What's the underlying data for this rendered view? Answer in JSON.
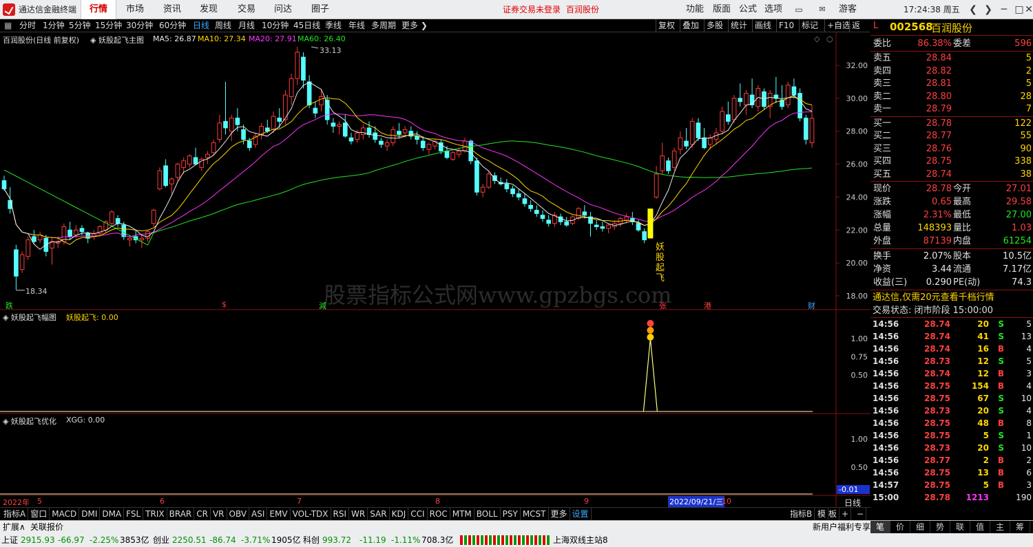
{
  "app": {
    "title": "通达信金融终端",
    "tabs": [
      "行情",
      "市场",
      "资讯",
      "发现",
      "交易",
      "问达",
      "圈子"
    ],
    "notice": "证券交易未登录",
    "stock_name_top": "百润股份",
    "menus": [
      "功能",
      "版面",
      "公式",
      "选项"
    ],
    "user": "游客",
    "time": "17:24:38 周五"
  },
  "periods": [
    "分时",
    "1分钟",
    "5分钟",
    "15分钟",
    "30分钟",
    "60分钟",
    "日线",
    "周线",
    "月线",
    "10分钟",
    "45日线",
    "季线",
    "年线",
    "多周期",
    "更多"
  ],
  "toolbar_right": [
    "复权",
    "叠加",
    "多股",
    "统计",
    "画线",
    "F10",
    "标记",
    "+自选",
    "返回"
  ],
  "main": {
    "title": "百润股份(日线 前复权)",
    "indicator": "妖股起飞主图",
    "ma5": "MA5: 26.87",
    "ma10": "MA10: 27.34",
    "ma20": "MA20: 27.91",
    "ma60": "MA60: 26.40",
    "high_mark": "33.13",
    "low_mark": "18.34",
    "yaxis": [
      "32.00",
      "30.00",
      "28.00",
      "26.00",
      "24.00",
      "22.00",
      "20.00",
      "18.00"
    ],
    "signal_text": [
      "妖",
      "股",
      "起",
      "飞"
    ],
    "watermark": "股票指标公式网www.gpzbgs.com",
    "events": [
      "跌",
      "$",
      "減",
      "张",
      "港",
      "财"
    ]
  },
  "sub1": {
    "title": "妖股起飞幅图",
    "value": "妖股起飞: 0.00",
    "yaxis": [
      "1.00",
      "0.75",
      "0.50"
    ]
  },
  "sub2": {
    "title": "妖股起飞优化",
    "value": "XGG: 0.00",
    "yaxis": [
      "1.00",
      "0.50",
      "-0.01"
    ]
  },
  "xaxis": {
    "labels": [
      "2022年",
      "5",
      "6",
      "7",
      "8",
      "9",
      "10"
    ],
    "cursor_date": "2022/09/21/三",
    "period": "日线"
  },
  "indicators": [
    "指标A",
    "窗口",
    "MACD",
    "DMI",
    "DMA",
    "FSL",
    "TRIX",
    "BRAR",
    "CR",
    "VR",
    "OBV",
    "ASI",
    "EMV",
    "VOL-TDX",
    "RSI",
    "WR",
    "SAR",
    "KDJ",
    "CCI",
    "ROC",
    "MTM",
    "BOLL",
    "PSY",
    "MCST",
    "更多",
    "设置"
  ],
  "indicators_right": [
    "指标B",
    "模",
    "板",
    "+",
    "−"
  ],
  "quote": {
    "code": "002568",
    "name": "百润股份",
    "weibi_label": "委比",
    "weibi": "86.38%",
    "weicha_label": "委差",
    "weicha": "596",
    "sells": [
      {
        "l": "卖五",
        "p": "28.84",
        "v": "5"
      },
      {
        "l": "卖四",
        "p": "28.82",
        "v": "2"
      },
      {
        "l": "卖三",
        "p": "28.81",
        "v": "5"
      },
      {
        "l": "卖二",
        "p": "28.80",
        "v": "28"
      },
      {
        "l": "卖一",
        "p": "28.79",
        "v": "7"
      }
    ],
    "buys": [
      {
        "l": "买一",
        "p": "28.78",
        "v": "122"
      },
      {
        "l": "买二",
        "p": "28.77",
        "v": "55"
      },
      {
        "l": "买三",
        "p": "28.76",
        "v": "90"
      },
      {
        "l": "买四",
        "p": "28.75",
        "v": "338"
      },
      {
        "l": "买五",
        "p": "28.74",
        "v": "38"
      }
    ],
    "stats": [
      [
        "现价",
        "28.78",
        "今开",
        "27.01"
      ],
      [
        "涨跌",
        "0.65",
        "最高",
        "29.58"
      ],
      [
        "涨幅",
        "2.31%",
        "最低",
        "27.00"
      ],
      [
        "总量",
        "148393",
        "量比",
        "1.03"
      ],
      [
        "外盘",
        "87139",
        "内盘",
        "61254"
      ],
      [
        "换手",
        "2.07%",
        "股本",
        "10.5亿"
      ],
      [
        "净资",
        "3.44",
        "流通",
        "7.17亿"
      ],
      [
        "收益(三)",
        "0.290",
        "PE(动)",
        "74.3"
      ]
    ],
    "ad": "通达信,仅需20元查看千档行情",
    "trade_status": "交易状态: 闭市阶段 15:00:00",
    "ticks": [
      [
        "14:56",
        "28.74",
        "20",
        "S",
        "5"
      ],
      [
        "14:56",
        "28.74",
        "41",
        "S",
        "13"
      ],
      [
        "14:56",
        "28.74",
        "16",
        "B",
        "4"
      ],
      [
        "14:56",
        "28.73",
        "12",
        "S",
        "5"
      ],
      [
        "14:56",
        "28.74",
        "12",
        "B",
        "3"
      ],
      [
        "14:56",
        "28.75",
        "154",
        "B",
        "4"
      ],
      [
        "14:56",
        "28.75",
        "67",
        "S",
        "10"
      ],
      [
        "14:56",
        "28.73",
        "20",
        "S",
        "4"
      ],
      [
        "14:56",
        "28.75",
        "48",
        "B",
        "8"
      ],
      [
        "14:56",
        "28.75",
        "5",
        "S",
        "1"
      ],
      [
        "14:56",
        "28.73",
        "20",
        "S",
        "10"
      ],
      [
        "14:56",
        "28.77",
        "2",
        "B",
        "2"
      ],
      [
        "14:56",
        "28.75",
        "13",
        "B",
        "6"
      ],
      [
        "14:57",
        "28.75",
        "5",
        "B",
        "3"
      ],
      [
        "15:00",
        "28.78",
        "1213",
        "",
        "190"
      ]
    ],
    "tabs": [
      "笔",
      "价",
      "细",
      "势",
      "联",
      "值",
      "主",
      "筹"
    ]
  },
  "statusbar": {
    "items": [
      [
        "上证",
        "2915.93",
        "-66.97",
        "-2.25%",
        "3853亿"
      ],
      [
        "创业",
        "2250.51",
        "-86.74",
        "-3.71%",
        "1905亿"
      ],
      [
        "科创",
        "993.72",
        "-11.19",
        "-1.11%",
        "708.3亿"
      ]
    ],
    "server": "上海双线主站8"
  },
  "extbar": {
    "left": [
      "扩展∧",
      "关联报价"
    ],
    "right": "新用户福利专享"
  },
  "candles": [
    [
      25.0,
      25.3,
      24.4,
      24.5
    ],
    [
      23.8,
      24.6,
      23.0,
      23.3
    ],
    [
      20.8,
      21.1,
      18.34,
      19.2
    ],
    [
      19.6,
      20.7,
      19.4,
      20.5
    ],
    [
      20.4,
      21.6,
      20.2,
      21.4
    ],
    [
      21.6,
      22.0,
      21.2,
      21.3
    ],
    [
      21.4,
      21.9,
      21.2,
      21.7
    ],
    [
      21.5,
      21.7,
      20.4,
      20.7
    ],
    [
      20.9,
      21.5,
      19.9,
      21.3
    ],
    [
      21.2,
      21.6,
      20.9,
      21.3
    ],
    [
      21.3,
      22.4,
      21.1,
      22.2
    ],
    [
      22.0,
      22.5,
      21.4,
      21.6
    ],
    [
      21.7,
      22.3,
      21.5,
      22.0
    ],
    [
      22.1,
      22.3,
      21.7,
      21.9
    ],
    [
      21.8,
      21.9,
      21.2,
      21.5
    ],
    [
      21.6,
      22.0,
      21.4,
      21.8
    ],
    [
      21.8,
      22.3,
      21.6,
      22.2
    ],
    [
      22.0,
      22.6,
      21.8,
      22.5
    ],
    [
      22.4,
      23.2,
      22.2,
      23.1
    ],
    [
      22.7,
      22.9,
      22.2,
      22.4
    ],
    [
      22.3,
      22.5,
      21.4,
      21.6
    ],
    [
      21.4,
      21.7,
      21.0,
      21.5
    ],
    [
      21.6,
      22.0,
      21.2,
      21.4
    ],
    [
      21.4,
      21.7,
      20.9,
      21.5
    ],
    [
      21.5,
      22.0,
      21.3,
      21.9
    ],
    [
      22.4,
      23.3,
      22.2,
      23.2
    ],
    [
      24.5,
      25.8,
      24.4,
      25.6
    ],
    [
      25.9,
      26.3,
      24.6,
      24.7
    ],
    [
      24.8,
      25.2,
      24.2,
      25.1
    ],
    [
      25.2,
      26.1,
      25.0,
      26.0
    ],
    [
      25.8,
      26.4,
      25.4,
      26.2
    ],
    [
      26.0,
      26.6,
      25.8,
      26.5
    ],
    [
      26.4,
      27.0,
      26.0,
      26.0
    ],
    [
      25.8,
      26.4,
      25.6,
      26.3
    ],
    [
      26.4,
      26.8,
      26.0,
      26.6
    ],
    [
      26.7,
      27.5,
      26.5,
      27.3
    ],
    [
      27.5,
      29.0,
      27.3,
      28.5
    ],
    [
      28.6,
      31.0,
      27.8,
      28.2
    ],
    [
      28.0,
      29.0,
      27.4,
      28.8
    ],
    [
      28.8,
      29.4,
      28.0,
      28.4
    ],
    [
      28.1,
      28.4,
      27.2,
      27.5
    ],
    [
      27.4,
      27.6,
      26.8,
      27.0
    ],
    [
      27.2,
      27.9,
      27.0,
      27.7
    ],
    [
      27.8,
      28.5,
      27.5,
      28.3
    ],
    [
      28.2,
      28.7,
      27.9,
      28.0
    ],
    [
      28.1,
      29.2,
      27.9,
      28.9
    ],
    [
      28.8,
      29.4,
      28.2,
      28.6
    ],
    [
      28.7,
      30.5,
      28.4,
      30.2
    ],
    [
      30.1,
      31.5,
      29.6,
      31.2
    ],
    [
      31.2,
      33.13,
      30.8,
      32.8
    ],
    [
      32.5,
      32.8,
      30.6,
      31.1
    ],
    [
      31.0,
      31.4,
      29.4,
      29.6
    ],
    [
      29.4,
      29.8,
      28.8,
      29.1
    ],
    [
      29.6,
      30.5,
      29.2,
      30.1
    ],
    [
      29.9,
      30.2,
      28.4,
      28.7
    ],
    [
      28.5,
      28.8,
      27.9,
      28.3
    ],
    [
      28.3,
      28.6,
      27.8,
      28.4
    ],
    [
      28.5,
      29.0,
      27.6,
      27.7
    ],
    [
      27.6,
      27.9,
      27.2,
      27.4
    ],
    [
      27.5,
      28.1,
      27.3,
      27.9
    ],
    [
      27.8,
      28.4,
      27.5,
      28.2
    ],
    [
      28.2,
      28.6,
      27.6,
      27.8
    ],
    [
      27.9,
      28.3,
      27.3,
      27.5
    ],
    [
      27.4,
      27.6,
      27.0,
      27.2
    ],
    [
      27.1,
      27.5,
      26.8,
      27.3
    ],
    [
      27.3,
      28.3,
      27.1,
      28.1
    ],
    [
      28.0,
      28.5,
      27.6,
      27.8
    ],
    [
      27.9,
      28.3,
      27.6,
      28.1
    ],
    [
      28.0,
      28.3,
      27.5,
      27.7
    ],
    [
      27.7,
      28.0,
      27.2,
      27.5
    ],
    [
      27.4,
      27.7,
      26.8,
      27.0
    ],
    [
      26.9,
      27.3,
      26.6,
      27.2
    ],
    [
      27.1,
      27.5,
      26.9,
      27.4
    ],
    [
      27.3,
      27.5,
      26.6,
      26.8
    ],
    [
      26.8,
      27.1,
      26.3,
      26.4
    ],
    [
      26.3,
      26.8,
      26.2,
      26.7
    ],
    [
      26.6,
      27.0,
      26.4,
      26.8
    ],
    [
      26.8,
      27.6,
      26.7,
      27.4
    ],
    [
      27.4,
      27.5,
      26.0,
      26.2
    ],
    [
      26.2,
      26.4,
      24.1,
      24.3
    ],
    [
      24.3,
      24.8,
      24.0,
      24.6
    ],
    [
      24.6,
      25.6,
      24.5,
      25.4
    ],
    [
      25.3,
      25.5,
      24.8,
      25.0
    ],
    [
      24.9,
      25.2,
      24.7,
      24.8
    ],
    [
      24.8,
      25.1,
      24.3,
      24.5
    ],
    [
      24.5,
      24.7,
      24.0,
      24.2
    ],
    [
      24.2,
      24.5,
      23.8,
      24.0
    ],
    [
      23.9,
      24.2,
      23.4,
      23.6
    ],
    [
      23.5,
      23.8,
      23.1,
      23.3
    ],
    [
      23.2,
      23.5,
      22.8,
      23.0
    ],
    [
      22.9,
      23.2,
      22.5,
      22.7
    ],
    [
      22.6,
      22.9,
      22.2,
      22.4
    ],
    [
      22.4,
      23.1,
      22.2,
      22.9
    ],
    [
      22.8,
      23.0,
      22.3,
      22.5
    ],
    [
      22.5,
      22.8,
      22.2,
      22.3
    ],
    [
      22.4,
      22.9,
      22.3,
      22.8
    ],
    [
      22.7,
      23.4,
      22.6,
      23.3
    ],
    [
      23.1,
      23.5,
      22.7,
      22.9
    ],
    [
      22.8,
      23.1,
      21.6,
      22.4
    ],
    [
      22.3,
      22.6,
      22.0,
      22.2
    ],
    [
      22.2,
      22.5,
      21.9,
      22.1
    ],
    [
      22.1,
      22.4,
      21.8,
      22.3
    ],
    [
      22.2,
      22.6,
      22.0,
      22.4
    ],
    [
      22.4,
      22.8,
      22.2,
      22.7
    ],
    [
      22.6,
      23.0,
      22.4,
      22.8
    ],
    [
      22.7,
      23.1,
      22.3,
      22.5
    ],
    [
      22.4,
      22.6,
      21.9,
      22.0
    ],
    [
      21.9,
      22.1,
      21.2,
      21.4
    ],
    [
      21.5,
      23.3,
      21.5,
      23.2
    ],
    [
      24.0,
      25.9,
      23.9,
      25.4
    ],
    [
      25.6,
      27.3,
      25.4,
      26.5
    ],
    [
      26.2,
      26.4,
      25.4,
      25.6
    ],
    [
      25.8,
      27.0,
      25.6,
      26.8
    ],
    [
      26.9,
      28.0,
      26.6,
      27.6
    ],
    [
      27.4,
      28.2,
      26.9,
      27.1
    ],
    [
      27.2,
      28.8,
      27.0,
      28.6
    ],
    [
      28.5,
      28.8,
      27.4,
      27.6
    ],
    [
      27.6,
      28.2,
      26.9,
      27.0
    ],
    [
      27.2,
      27.8,
      26.9,
      27.6
    ],
    [
      27.5,
      28.2,
      27.2,
      27.9
    ],
    [
      28.0,
      29.5,
      27.8,
      29.2
    ],
    [
      29.0,
      29.8,
      28.4,
      28.6
    ],
    [
      28.7,
      30.2,
      28.5,
      30.0
    ],
    [
      30.0,
      30.9,
      29.5,
      29.8
    ],
    [
      29.6,
      30.5,
      29.0,
      30.3
    ],
    [
      30.2,
      31.2,
      29.4,
      29.6
    ],
    [
      29.5,
      30.8,
      29.2,
      30.6
    ],
    [
      30.4,
      30.6,
      29.3,
      29.5
    ],
    [
      29.5,
      30.5,
      28.8,
      30.3
    ],
    [
      30.2,
      31.3,
      29.7,
      30.0
    ],
    [
      29.9,
      30.8,
      29.3,
      29.5
    ],
    [
      29.6,
      31.0,
      29.4,
      30.8
    ],
    [
      30.7,
      31.2,
      30.0,
      30.2
    ],
    [
      30.3,
      30.6,
      28.6,
      28.8
    ],
    [
      28.8,
      29.0,
      27.2,
      27.5
    ],
    [
      27.3,
      29.58,
      27.0,
      28.78
    ]
  ]
}
